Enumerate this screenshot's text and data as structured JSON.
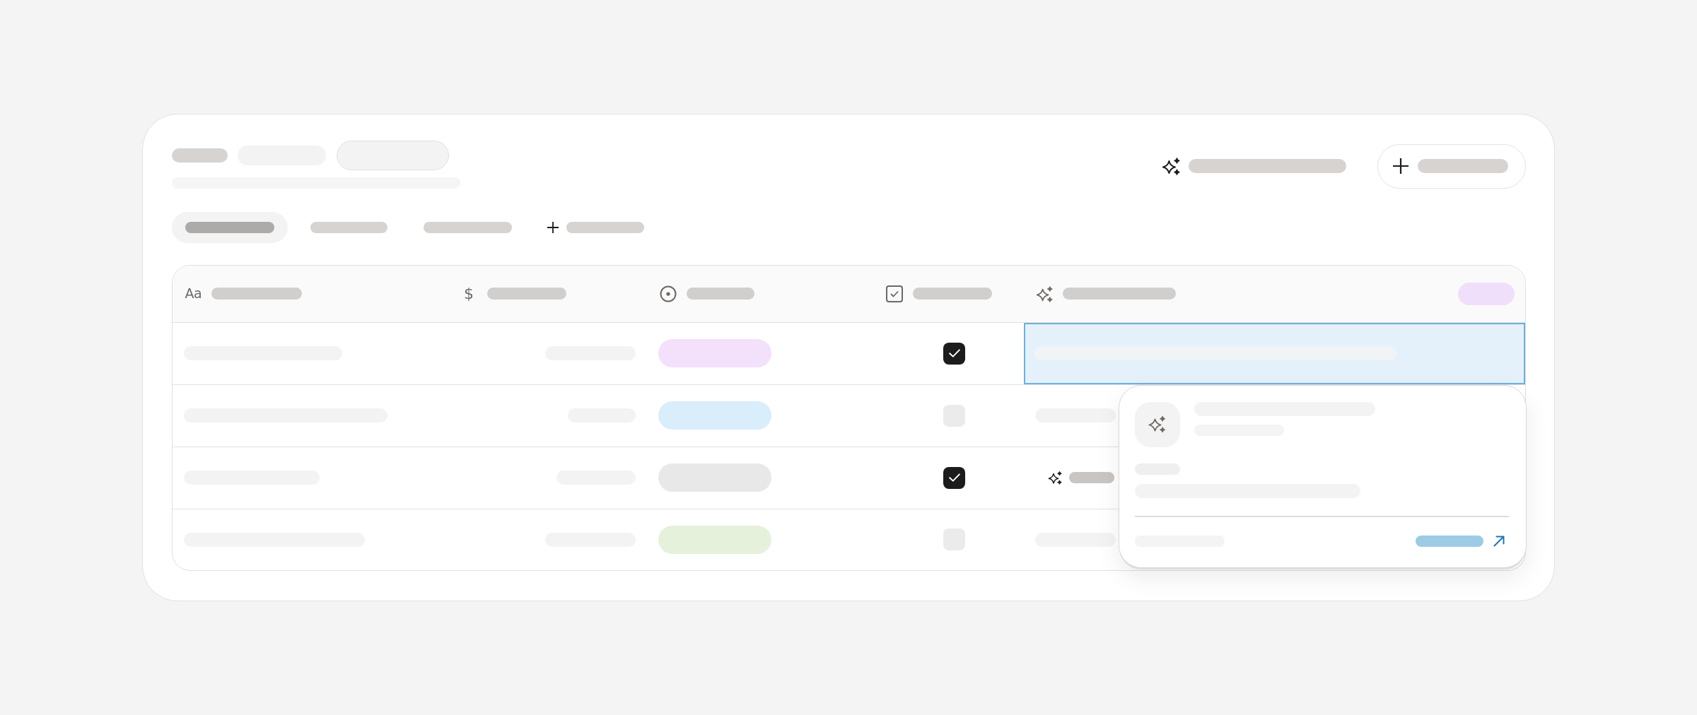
{
  "tabs": [
    {
      "selected": true
    },
    {
      "selected": false
    },
    {
      "selected": false
    }
  ],
  "table": {
    "columns": [
      {
        "kind": "text",
        "icon": "Aa"
      },
      {
        "kind": "number",
        "icon": "$"
      },
      {
        "kind": "status"
      },
      {
        "kind": "checkbox"
      },
      {
        "kind": "ai"
      }
    ],
    "rows": [
      {
        "tag": {
          "color": "#f3e0fb"
        },
        "checked": true,
        "ai": {
          "selected": true,
          "generating": false
        }
      },
      {
        "tag": {
          "color": "#d9edfb"
        },
        "checked": false,
        "ai": {
          "selected": false,
          "generating": false
        }
      },
      {
        "tag": {
          "color": "#e8e8e8"
        },
        "checked": true,
        "ai": {
          "selected": false,
          "generating": true
        }
      },
      {
        "tag": {
          "color": "#e6f1dc"
        },
        "checked": false,
        "ai": {
          "selected": false,
          "generating": false
        }
      }
    ]
  }
}
